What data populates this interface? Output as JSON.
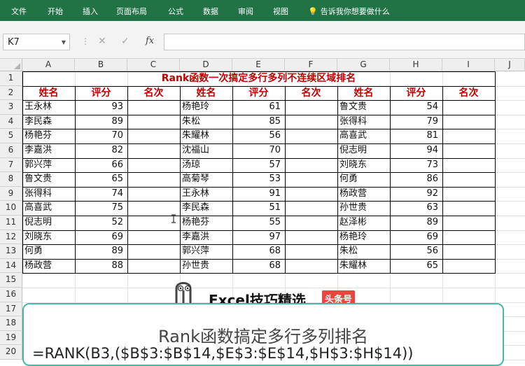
{
  "ribbon": {
    "tabs": [
      "文件",
      "开始",
      "插入",
      "页面布局",
      "公式",
      "数据",
      "审阅",
      "视图"
    ],
    "tell_me": "告诉我你想要做什么"
  },
  "formula_bar": {
    "name_box": "K7",
    "fx": "fx",
    "formula": ""
  },
  "columns": [
    "A",
    "B",
    "C",
    "D",
    "E",
    "F",
    "G",
    "H",
    "I",
    "J"
  ],
  "rows": [
    "1",
    "2",
    "3",
    "4",
    "5",
    "6",
    "7",
    "8",
    "9",
    "10",
    "11",
    "12",
    "13",
    "14",
    "15",
    "16",
    "17",
    "18",
    "19",
    "20"
  ],
  "sheet": {
    "title": "Rank函数一次搞定多行多列不连续区域排名",
    "headers": [
      "姓名",
      "评分",
      "名次",
      "姓名",
      "评分",
      "名次",
      "姓名",
      "评分",
      "名次"
    ],
    "data": [
      [
        "王永林",
        "93",
        "",
        "杨艳玲",
        "61",
        "",
        "鲁文贵",
        "54",
        ""
      ],
      [
        "李民森",
        "89",
        "",
        "朱松",
        "85",
        "",
        "张得科",
        "79",
        ""
      ],
      [
        "杨艳芬",
        "70",
        "",
        "朱耀林",
        "56",
        "",
        "高喜武",
        "81",
        ""
      ],
      [
        "李嘉洪",
        "82",
        "",
        "沈福山",
        "70",
        "",
        "倪志明",
        "94",
        ""
      ],
      [
        "郭兴萍",
        "66",
        "",
        "汤琼",
        "57",
        "",
        "刘晓东",
        "73",
        ""
      ],
      [
        "鲁文贵",
        "65",
        "",
        "高菊琴",
        "53",
        "",
        "何勇",
        "86",
        ""
      ],
      [
        "张得科",
        "74",
        "",
        "王永林",
        "91",
        "",
        "杨政营",
        "92",
        ""
      ],
      [
        "高喜武",
        "75",
        "",
        "李民森",
        "51",
        "",
        "孙世贵",
        "63",
        ""
      ],
      [
        "倪志明",
        "52",
        "",
        "杨艳芬",
        "55",
        "",
        "赵泽彬",
        "89",
        ""
      ],
      [
        "刘晓东",
        "69",
        "",
        "李嘉洪",
        "97",
        "",
        "杨艳玲",
        "69",
        ""
      ],
      [
        "何勇",
        "89",
        "",
        "郭兴萍",
        "68",
        "",
        "朱松",
        "56",
        ""
      ],
      [
        "杨政营",
        "88",
        "",
        "孙世贵",
        "68",
        "",
        "朱耀林",
        "65",
        ""
      ]
    ]
  },
  "brand": {
    "name": "Excel技巧精选",
    "badge": "头条号"
  },
  "overlay": {
    "title": "Rank函数搞定多行多列排名",
    "formula": "=RANK(B3,($B$3:$B$14,$E$3:$E$14,$H$3:$H$14))"
  },
  "colors": {
    "ribbon": "#217346",
    "header_red": "#c00000",
    "panel_border": "#4ab8a6",
    "badge": "#e8453c"
  }
}
